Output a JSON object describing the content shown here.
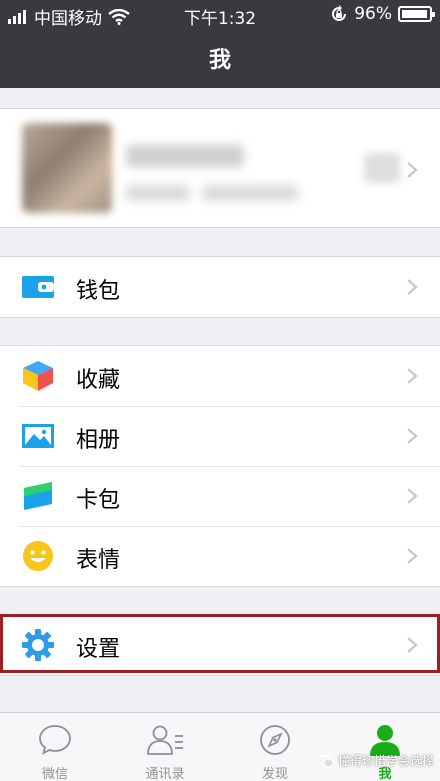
{
  "status_bar": {
    "carrier": "中国移动",
    "time": "下午1:32",
    "battery": "96%",
    "battery_level": 0.96
  },
  "nav": {
    "title": "我"
  },
  "menu": {
    "wallet": "钱包",
    "favorites": "收藏",
    "album": "相册",
    "cards": "卡包",
    "stickers": "表情",
    "settings": "设置"
  },
  "tabs": [
    {
      "label": "微信",
      "icon": "chat-bubble-icon",
      "active": false
    },
    {
      "label": "通讯录",
      "icon": "contacts-icon",
      "active": false
    },
    {
      "label": "发现",
      "icon": "compass-icon",
      "active": false
    },
    {
      "label": "我",
      "icon": "person-icon",
      "active": true
    }
  ],
  "watermark": "懂得珍惜学会选择",
  "colors": {
    "nav_bg": "#393a3f",
    "accent": "#1aad19",
    "highlight_border": "#9b1f24",
    "wallet_blue": "#1aa3e8",
    "settings_blue": "#2e9be6",
    "sticker_yellow": "#f8c51c"
  }
}
